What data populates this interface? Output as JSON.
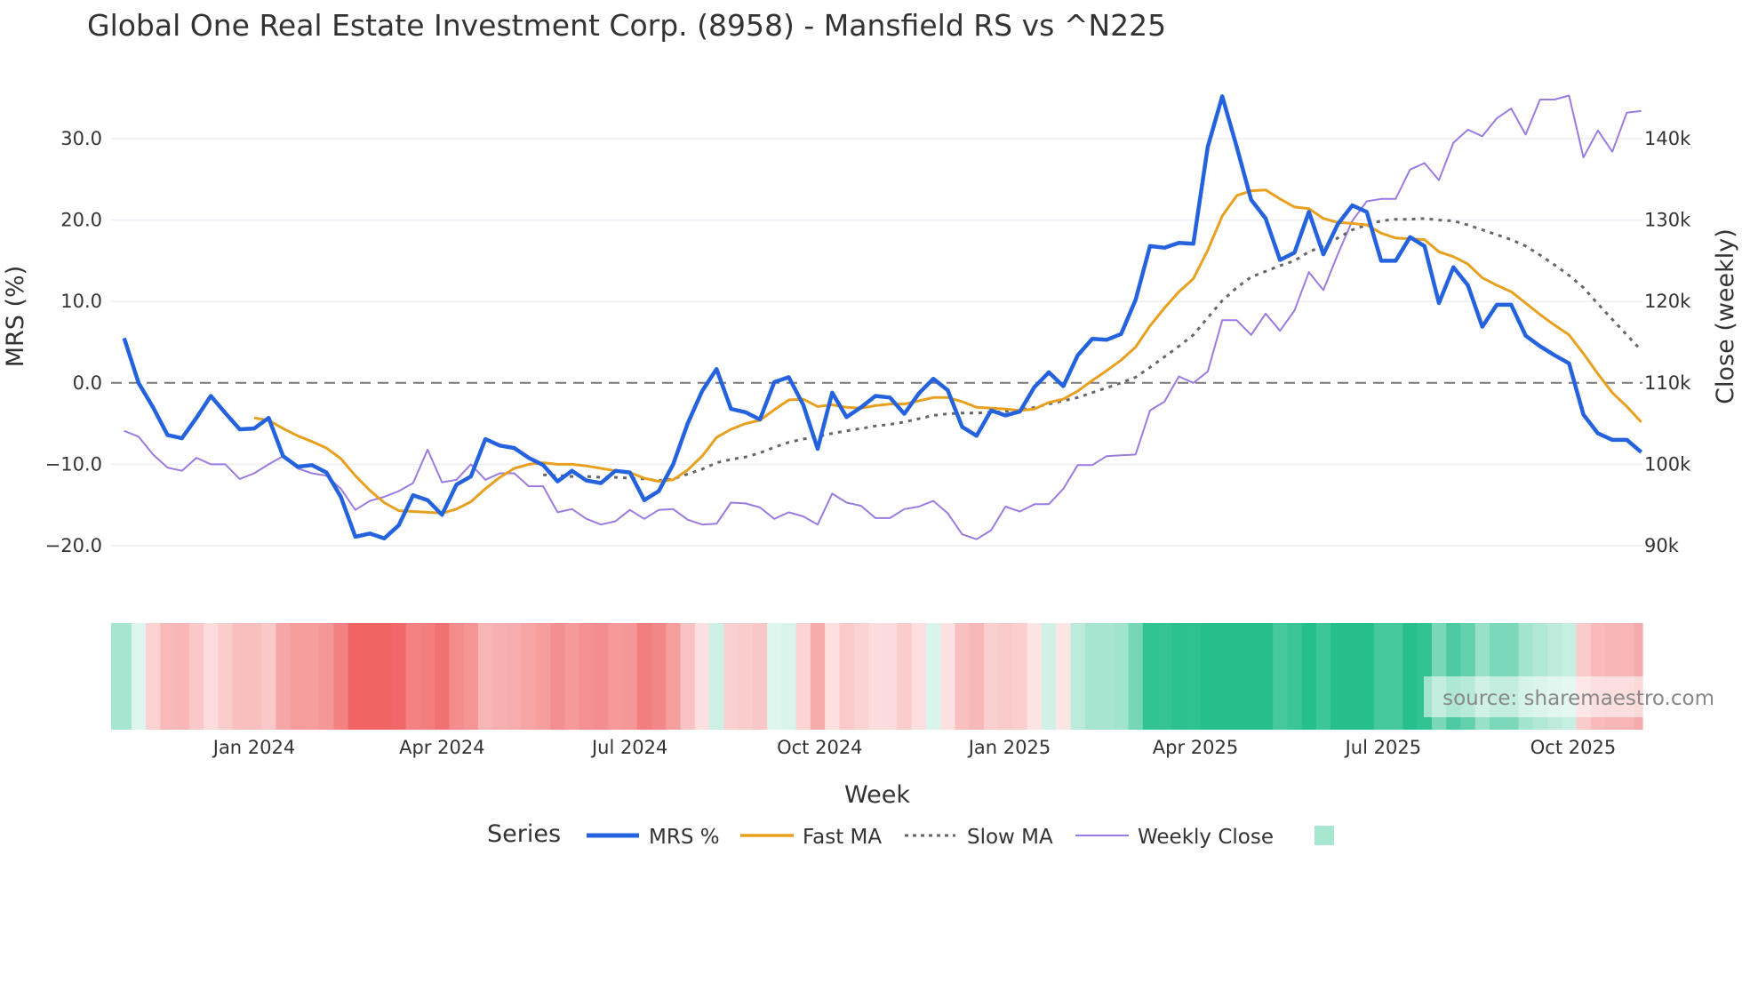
{
  "chart_data": {
    "type": "line",
    "title": "Global One Real Estate Investment Corp. (8958) - Mansfield RS vs ^N225",
    "xlabel": "Week",
    "ylabel": "MRS (%)",
    "y2label": "Close (weekly)",
    "x_start": "2023-10-30",
    "x_step_days": 7,
    "ylim": [
      -24,
      37
    ],
    "y2lim": [
      86000,
      147000
    ],
    "y_ticks": [
      "30.0",
      "20.0",
      "10.0",
      "0.0",
      "−10.0",
      "−20.0"
    ],
    "y_tick_values": [
      30,
      20,
      10,
      0,
      -10,
      -20
    ],
    "y2_ticks": [
      "140k",
      "130k",
      "120k",
      "110k",
      "100k",
      "90k"
    ],
    "y2_tick_values": [
      140000,
      130000,
      120000,
      110000,
      100000,
      90000
    ],
    "x_ticks": [
      "Jan 2024",
      "Apr 2024",
      "Jul 2024",
      "Oct 2024",
      "Jan 2025",
      "Apr 2025",
      "Jul 2025",
      "Oct 2025"
    ],
    "x_tick_dates": [
      "2024-01-01",
      "2024-04-01",
      "2024-07-01",
      "2024-10-01",
      "2025-01-01",
      "2025-04-01",
      "2025-07-01",
      "2025-10-01"
    ],
    "zero_line": "dashed",
    "grid": true,
    "legend": {
      "title": "Series",
      "placement": "bottom"
    },
    "series": [
      {
        "name": "MRS %",
        "color": "#2563de",
        "axis": "left",
        "start_index": 0,
        "values": [
          5.5,
          0,
          -3,
          -6.4,
          -6.8,
          -4.3,
          -1.6,
          -3.7,
          -5.7,
          -5.6,
          -4.3,
          -9,
          -10.3,
          -10.1,
          -11,
          -14,
          -18.9,
          -18.5,
          -19.1,
          -17.5,
          -13.8,
          -14.4,
          -16.2,
          -12.5,
          -11.5,
          -6.9,
          -7.7,
          -8,
          -9.2,
          -10.1,
          -12.1,
          -10.8,
          -12,
          -12.3,
          -10.8,
          -11,
          -14.4,
          -13.3,
          -10,
          -5,
          -1,
          1.7,
          -3.2,
          -3.6,
          -4.5,
          0.1,
          0.7,
          -2.7,
          -8.1,
          -1.2,
          -4.2,
          -3,
          -1.6,
          -1.8,
          -3.8,
          -1.3,
          0.5,
          -0.9,
          -5.4,
          -6.5,
          -3.4,
          -4,
          -3.5,
          -0.5,
          1.3,
          -0.4,
          3.4,
          5.4,
          5.3,
          6,
          10.2,
          16.8,
          16.6,
          17.2,
          17.1,
          29,
          35.2,
          29,
          22.5,
          20.2,
          15.1,
          16,
          21,
          15.8,
          19.5,
          21.8,
          21,
          15,
          15,
          17.9,
          16.8,
          9.8,
          14.2,
          12,
          6.9,
          9.6,
          9.6,
          5.8,
          4.5,
          3.4,
          2.4,
          -3.9,
          -6.2,
          -7,
          -7,
          -8.5
        ]
      },
      {
        "name": "Fast MA",
        "color": "#e8a020",
        "axis": "left",
        "start_index": 9,
        "values": [
          -4.3,
          -4.6,
          -5.6,
          -6.5,
          -7.2,
          -8,
          -9.3,
          -11.4,
          -13.2,
          -14.7,
          -15.7,
          -15.8,
          -15.9,
          -16,
          -15.5,
          -14.6,
          -13,
          -11.6,
          -10.5,
          -10,
          -9.8,
          -10,
          -10,
          -10.2,
          -10.5,
          -10.8,
          -11,
          -11.7,
          -12.1,
          -11.9,
          -10.7,
          -9,
          -6.7,
          -5.7,
          -5,
          -4.6,
          -3.3,
          -2.1,
          -2,
          -2.9,
          -2.7,
          -3,
          -3.1,
          -2.8,
          -2.6,
          -2.6,
          -2.2,
          -1.8,
          -1.8,
          -2.3,
          -3,
          -3.1,
          -3.2,
          -3.4,
          -3.2,
          -2.4,
          -2,
          -1,
          0.3,
          1.5,
          2.8,
          4.4,
          7,
          9.2,
          11.2,
          12.8,
          16.3,
          20.5,
          23,
          23.6,
          23.7,
          22.6,
          21.6,
          21.4,
          20.2,
          19.7,
          19.6,
          19.4,
          18.4,
          17.8,
          17.7,
          17.6,
          16.1,
          15.5,
          14.6,
          12.9,
          12,
          11.2,
          9.8,
          8.4,
          7.1,
          5.9,
          3.6,
          1.1,
          -1.2,
          -2.9,
          -4.8
        ]
      },
      {
        "name": "Slow MA",
        "color": "#666666",
        "axis": "left",
        "start_index": 29,
        "values": [
          -11.3,
          -11.4,
          -11.5,
          -11.5,
          -11.6,
          -11.6,
          -11.7,
          -11.8,
          -12,
          -11.8,
          -11.2,
          -10.6,
          -9.8,
          -9.4,
          -9.1,
          -8.6,
          -7.9,
          -7.3,
          -6.9,
          -6.6,
          -6.2,
          -5.9,
          -5.6,
          -5.3,
          -5.1,
          -4.8,
          -4.4,
          -4,
          -3.8,
          -3.7,
          -3.7,
          -3.6,
          -3.5,
          -3.3,
          -3,
          -2.6,
          -2.2,
          -1.8,
          -1.2,
          -0.6,
          0,
          0.7,
          1.9,
          3.2,
          4.5,
          5.9,
          8,
          10.1,
          11.7,
          13,
          13.7,
          14.4,
          15,
          16.1,
          16.8,
          17.8,
          18.8,
          19.4,
          19.9,
          20.1,
          20.1,
          20.2,
          20,
          19.9,
          19.4,
          18.8,
          18.2,
          17.6,
          16.8,
          15.7,
          14.5,
          13.2,
          11.7,
          9.7,
          7.8,
          5.9,
          4
        ]
      },
      {
        "name": "Weekly Close",
        "color": "#9b7be0",
        "axis": "right",
        "start_index": 0,
        "values": [
          104100,
          103400,
          101200,
          99600,
          99200,
          100800,
          100000,
          100000,
          98200,
          98900,
          100000,
          101000,
          99500,
          98900,
          98600,
          97000,
          94400,
          95500,
          96000,
          96700,
          97700,
          101800,
          97800,
          98100,
          100000,
          98100,
          98900,
          98900,
          97300,
          97300,
          94100,
          94500,
          93300,
          92600,
          93000,
          94400,
          93300,
          94400,
          94500,
          93200,
          92600,
          92700,
          95300,
          95200,
          94700,
          93300,
          94100,
          93600,
          92600,
          96400,
          95300,
          94900,
          93400,
          93400,
          94500,
          94800,
          95500,
          94000,
          91400,
          90800,
          91900,
          94800,
          94200,
          95100,
          95100,
          97000,
          99900,
          99900,
          101000,
          101100,
          101200,
          106600,
          107700,
          110800,
          110000,
          111400,
          117700,
          117700,
          115900,
          118500,
          116400,
          118900,
          123600,
          121400,
          125800,
          129900,
          132300,
          132600,
          132600,
          136200,
          137000,
          134900,
          139500,
          141100,
          140300,
          142500,
          143700,
          140500,
          144800,
          144800,
          145300,
          137700,
          141000,
          138400,
          143200,
          143400
        ]
      }
    ],
    "heatmap": {
      "basis": "MRS %",
      "positive_color": "#26bf8c",
      "negative_color": "#f06464"
    }
  },
  "watermark": "source: sharemaestro.com",
  "legend_swatch_color": "#a8e6cf"
}
